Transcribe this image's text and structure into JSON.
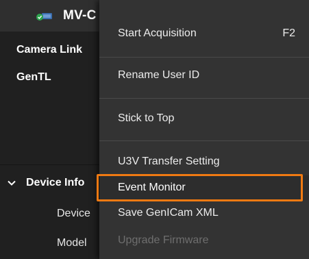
{
  "camera_panel": {
    "title": "MV-C",
    "tree": [
      "Camera Link",
      "GenTL"
    ],
    "device_info": {
      "label": "Device Info",
      "properties": [
        "Device",
        "Model"
      ]
    }
  },
  "context_menu": {
    "items": [
      {
        "label": "Start Acquisition",
        "shortcut": "F2",
        "enabled": true
      },
      {
        "label": "Rename User ID",
        "enabled": true
      },
      {
        "label": "Stick to Top",
        "enabled": true
      },
      {
        "label": "U3V Transfer Setting",
        "enabled": true
      },
      {
        "label": "Event Monitor",
        "enabled": true,
        "highlighted": true
      },
      {
        "label": "Save GenICam XML",
        "enabled": true
      },
      {
        "label": "Upgrade Firmware",
        "enabled": false
      }
    ]
  },
  "colors": {
    "highlight_outline": "#f07a12",
    "camera_icon_status": "#2ea44f"
  },
  "icons": [
    "camera-icon",
    "chevron-down-icon"
  ]
}
